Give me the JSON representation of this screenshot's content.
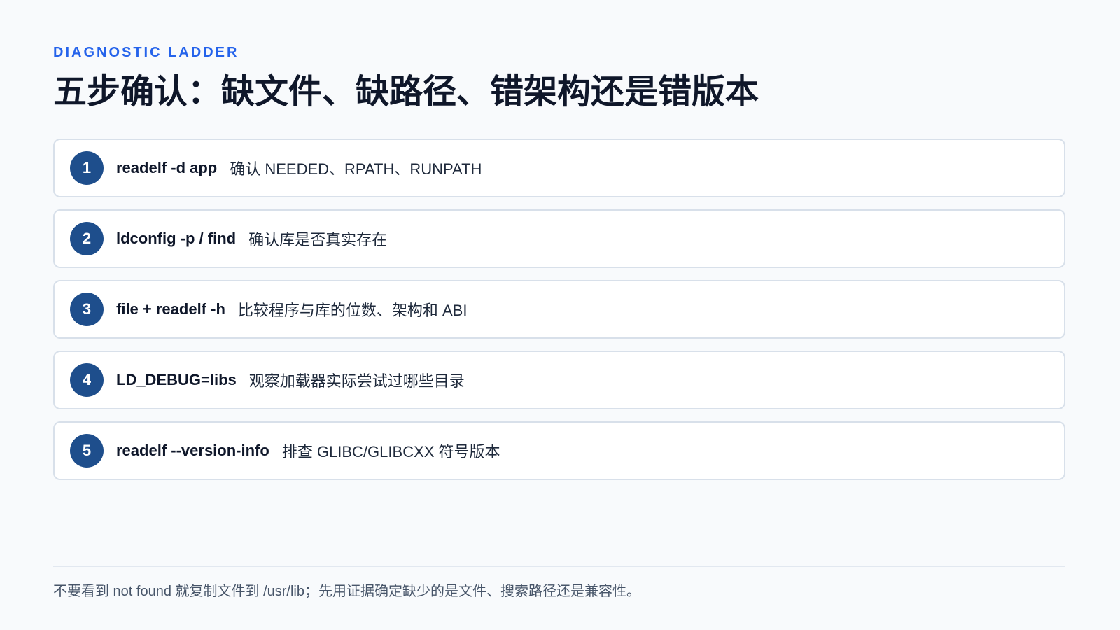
{
  "eyebrow": "DIAGNOSTIC LADDER",
  "title": "五步确认：缺文件、缺路径、错架构还是错版本",
  "steps": [
    {
      "number": "1",
      "command": "readelf -d app",
      "description": "确认 NEEDED、RPATH、RUNPATH"
    },
    {
      "number": "2",
      "command": "ldconfig -p / find",
      "description": "确认库是否真实存在"
    },
    {
      "number": "3",
      "command": "file + readelf -h",
      "description": "比较程序与库的位数、架构和 ABI"
    },
    {
      "number": "4",
      "command": "LD_DEBUG=libs",
      "description": "观察加载器实际尝试过哪些目录"
    },
    {
      "number": "5",
      "command": "readelf --version-info",
      "description": "排查 GLIBC/GLIBCXX 符号版本"
    }
  ],
  "footnote": "不要看到 not found 就复制文件到 /usr/lib；先用证据确定缺少的是文件、搜索路径还是兼容性。",
  "colors": {
    "accent": "#2563eb",
    "badge": "#1e4e8c",
    "background": "#f8fafc"
  }
}
